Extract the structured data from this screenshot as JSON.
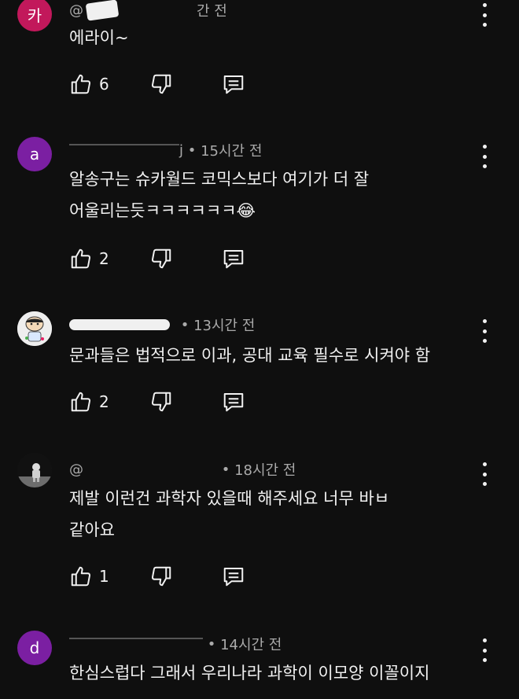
{
  "comments": [
    {
      "avatar_letter": "카",
      "avatar_color": "#c2185b",
      "author": "@",
      "time": "간 전",
      "text": "에라이~",
      "likes": "6"
    },
    {
      "avatar_letter": "a",
      "avatar_color": "#7b1fa2",
      "author": "j",
      "time": "15시간 전",
      "text": "알송구는 슈카월드 코믹스보다 여기가 더 잘\n어울리는듯ㅋㅋㅋㅋㅋㅋ😂",
      "likes": "2"
    },
    {
      "avatar_letter": "",
      "avatar_color": "#e8e8e8",
      "author": "",
      "time": "13시간 전",
      "text": "문과들은 법적으로 이과, 공대 교육 필수로 시켜야 함",
      "likes": "2"
    },
    {
      "avatar_letter": "",
      "avatar_color": "#1a1a1a",
      "author": "@",
      "time": "18시간 전",
      "text": "제발 이런건 과학자 있을때 해주세요 너무 바ㅂ\n같아요",
      "likes": "1"
    },
    {
      "avatar_letter": "d",
      "avatar_color": "#7b1fa2",
      "author": "",
      "time": "14시간 전",
      "text": "한심스럽다 그래서 우리나라 과학이 이모양 이꼴이지",
      "likes": ""
    }
  ],
  "icons": {
    "like": "thumbs-up-icon",
    "dislike": "thumbs-down-icon",
    "reply": "reply-comment-icon",
    "more": "more-vert-icon"
  }
}
